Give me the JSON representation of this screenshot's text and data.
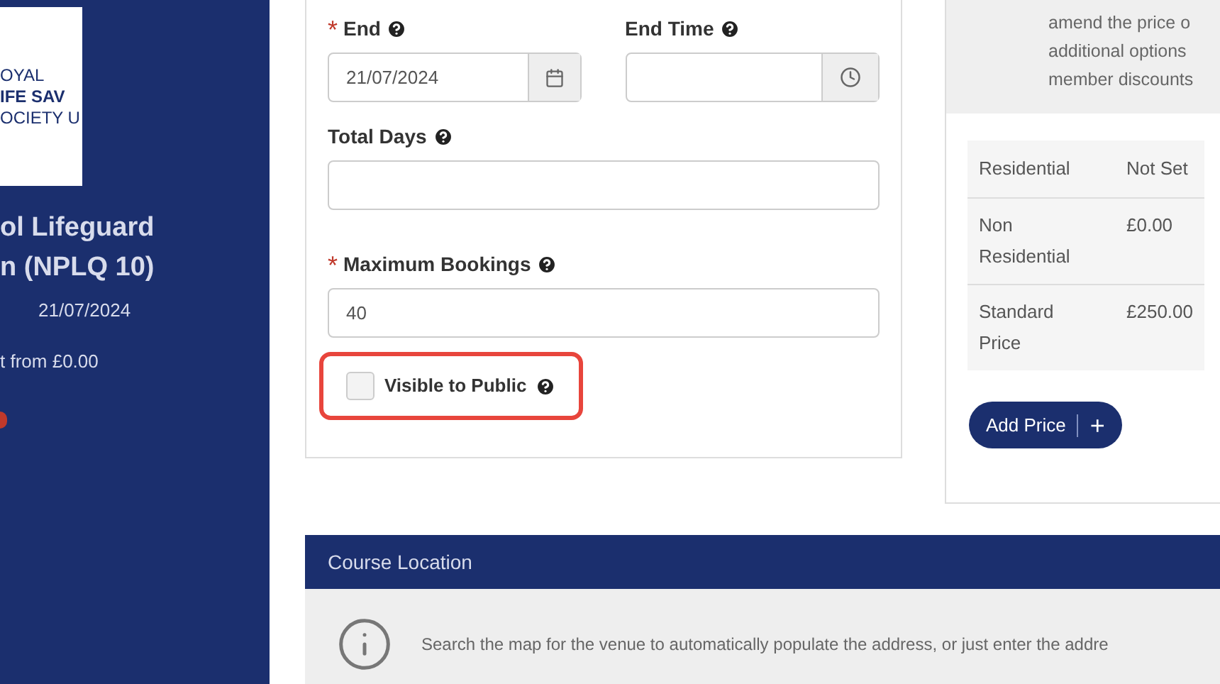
{
  "sidebar": {
    "logo_lines": [
      "OYAL",
      "IFE SAV",
      "OCIETY U"
    ],
    "title_lines": [
      "ol Lifeguard",
      "n (NPLQ 10)"
    ],
    "date": "21/07/2024",
    "price": "t from £0.00"
  },
  "form": {
    "required_mark": "*",
    "end": {
      "label": "End",
      "required": true,
      "value": "21/07/2024"
    },
    "end_time": {
      "label": "End Time"
    },
    "total_days": {
      "label": "Total Days"
    },
    "max_bookings": {
      "label": "Maximum Bookings",
      "required": true,
      "value": "40"
    },
    "visible_to_public": {
      "label": "Visible to Public",
      "checked": false,
      "highlighted": true
    }
  },
  "pricing": {
    "info_lines": [
      "amend the price o",
      "additional options",
      "member discounts"
    ],
    "rows": [
      {
        "name": "Residential",
        "price": "Not Set"
      },
      {
        "name": "Non Residential",
        "price": "£0.00"
      },
      {
        "name": "Standard Price",
        "price": "£250.00"
      }
    ],
    "add_button": {
      "label": "Add Price",
      "icon": "+"
    }
  },
  "location": {
    "title": "Course Location",
    "info": "Search the map for the venue to automatically populate the address, or just enter the addre"
  }
}
